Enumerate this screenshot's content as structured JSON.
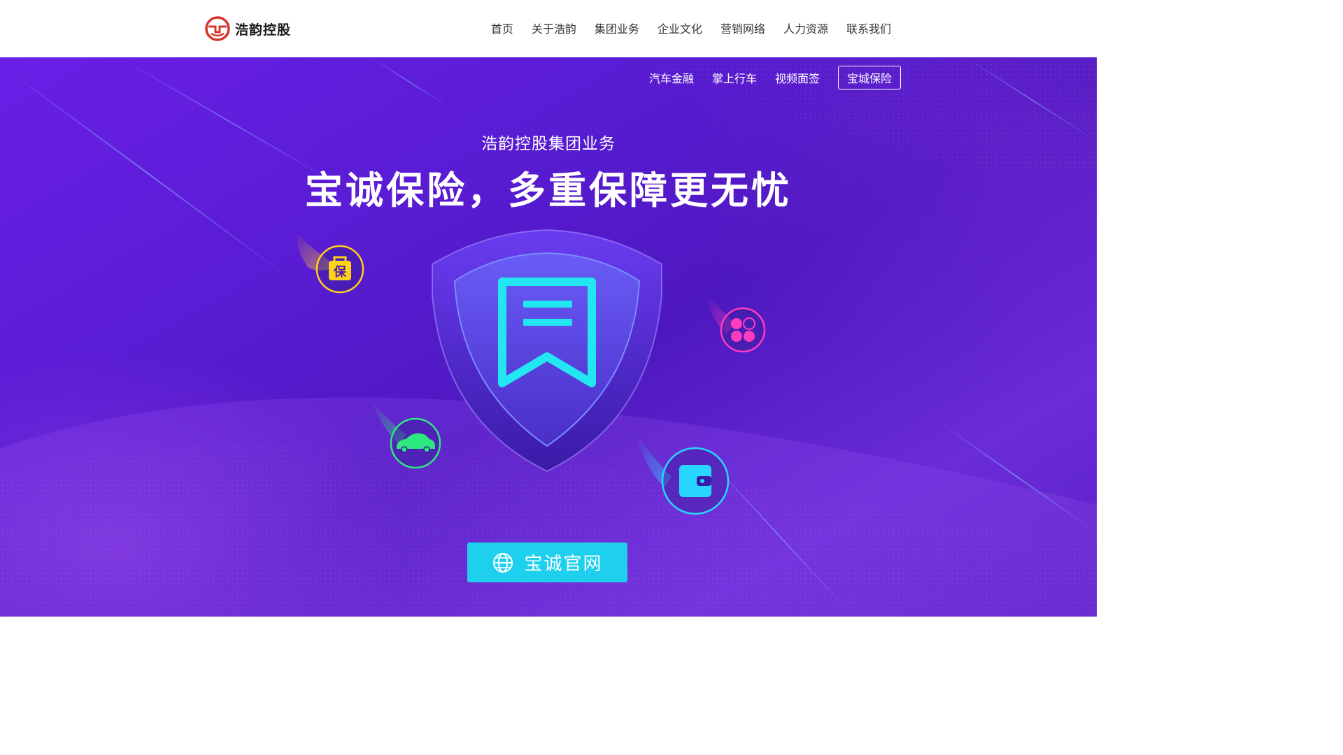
{
  "header": {
    "logo_text": "浩韵控股",
    "nav": [
      "首页",
      "关于浩韵",
      "集团业务",
      "企业文化",
      "营销网络",
      "人力资源",
      "联系我们"
    ]
  },
  "subnav": {
    "items": [
      "汽车金融",
      "掌上行车",
      "视频面签",
      "宝城保险"
    ],
    "active": "宝城保险"
  },
  "hero": {
    "kicker": "浩韵控股集团业务",
    "headline": "宝诚保险，多重保障更无忧",
    "badge_text": "保",
    "cta_label": "宝诚官网"
  },
  "colors": {
    "brand_red": "#d6342c",
    "hero_purple": "#5a1cd4",
    "cta_cyan": "#1fcfee",
    "badge_yellow": "#ffd21a",
    "badge_pink": "#ff3cc0",
    "badge_green": "#2de87e",
    "badge_cyan": "#29d6ff"
  },
  "icons": [
    "logo-mark-icon",
    "insurance-bag-icon",
    "car-icon",
    "clover-icon",
    "wallet-icon",
    "shield-icon",
    "globe-icon"
  ]
}
